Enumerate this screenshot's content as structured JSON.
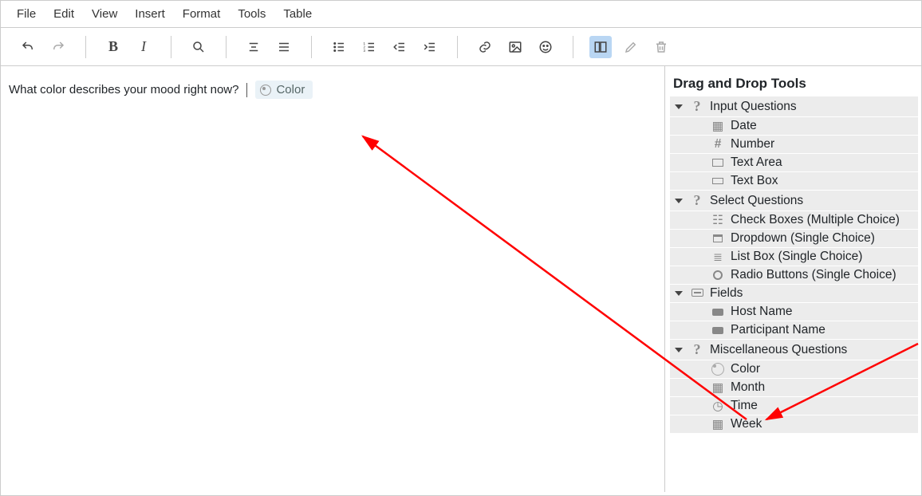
{
  "menu": {
    "file": "File",
    "edit": "Edit",
    "view": "View",
    "insert": "Insert",
    "format": "Format",
    "tools": "Tools",
    "table": "Table"
  },
  "editor": {
    "question_text": "What color describes your mood right now?",
    "chip_label": "Color"
  },
  "sidebar": {
    "title": "Drag and Drop Tools",
    "cats": [
      {
        "label": "Input Questions",
        "icon": "question",
        "items": [
          {
            "label": "Date",
            "icon": "grid"
          },
          {
            "label": "Number",
            "icon": "hash"
          },
          {
            "label": "Text Area",
            "icon": "rect"
          },
          {
            "label": "Text Box",
            "icon": "rect-small"
          }
        ]
      },
      {
        "label": "Select Questions",
        "icon": "question",
        "items": [
          {
            "label": "Check Boxes (Multiple Choice)",
            "icon": "check"
          },
          {
            "label": "Dropdown (Single Choice)",
            "icon": "drop"
          },
          {
            "label": "List Box (Single Choice)",
            "icon": "list"
          },
          {
            "label": "Radio Buttons (Single Choice)",
            "icon": "radio"
          }
        ]
      },
      {
        "label": "Fields",
        "icon": "field",
        "items": [
          {
            "label": "Host Name",
            "icon": "tag"
          },
          {
            "label": "Participant Name",
            "icon": "tag"
          }
        ]
      },
      {
        "label": "Miscellaneous Questions",
        "icon": "question",
        "items": [
          {
            "label": "Color",
            "icon": "palette"
          },
          {
            "label": "Month",
            "icon": "cal"
          },
          {
            "label": "Time",
            "icon": "clock"
          },
          {
            "label": "Week",
            "icon": "cal"
          }
        ]
      }
    ]
  }
}
